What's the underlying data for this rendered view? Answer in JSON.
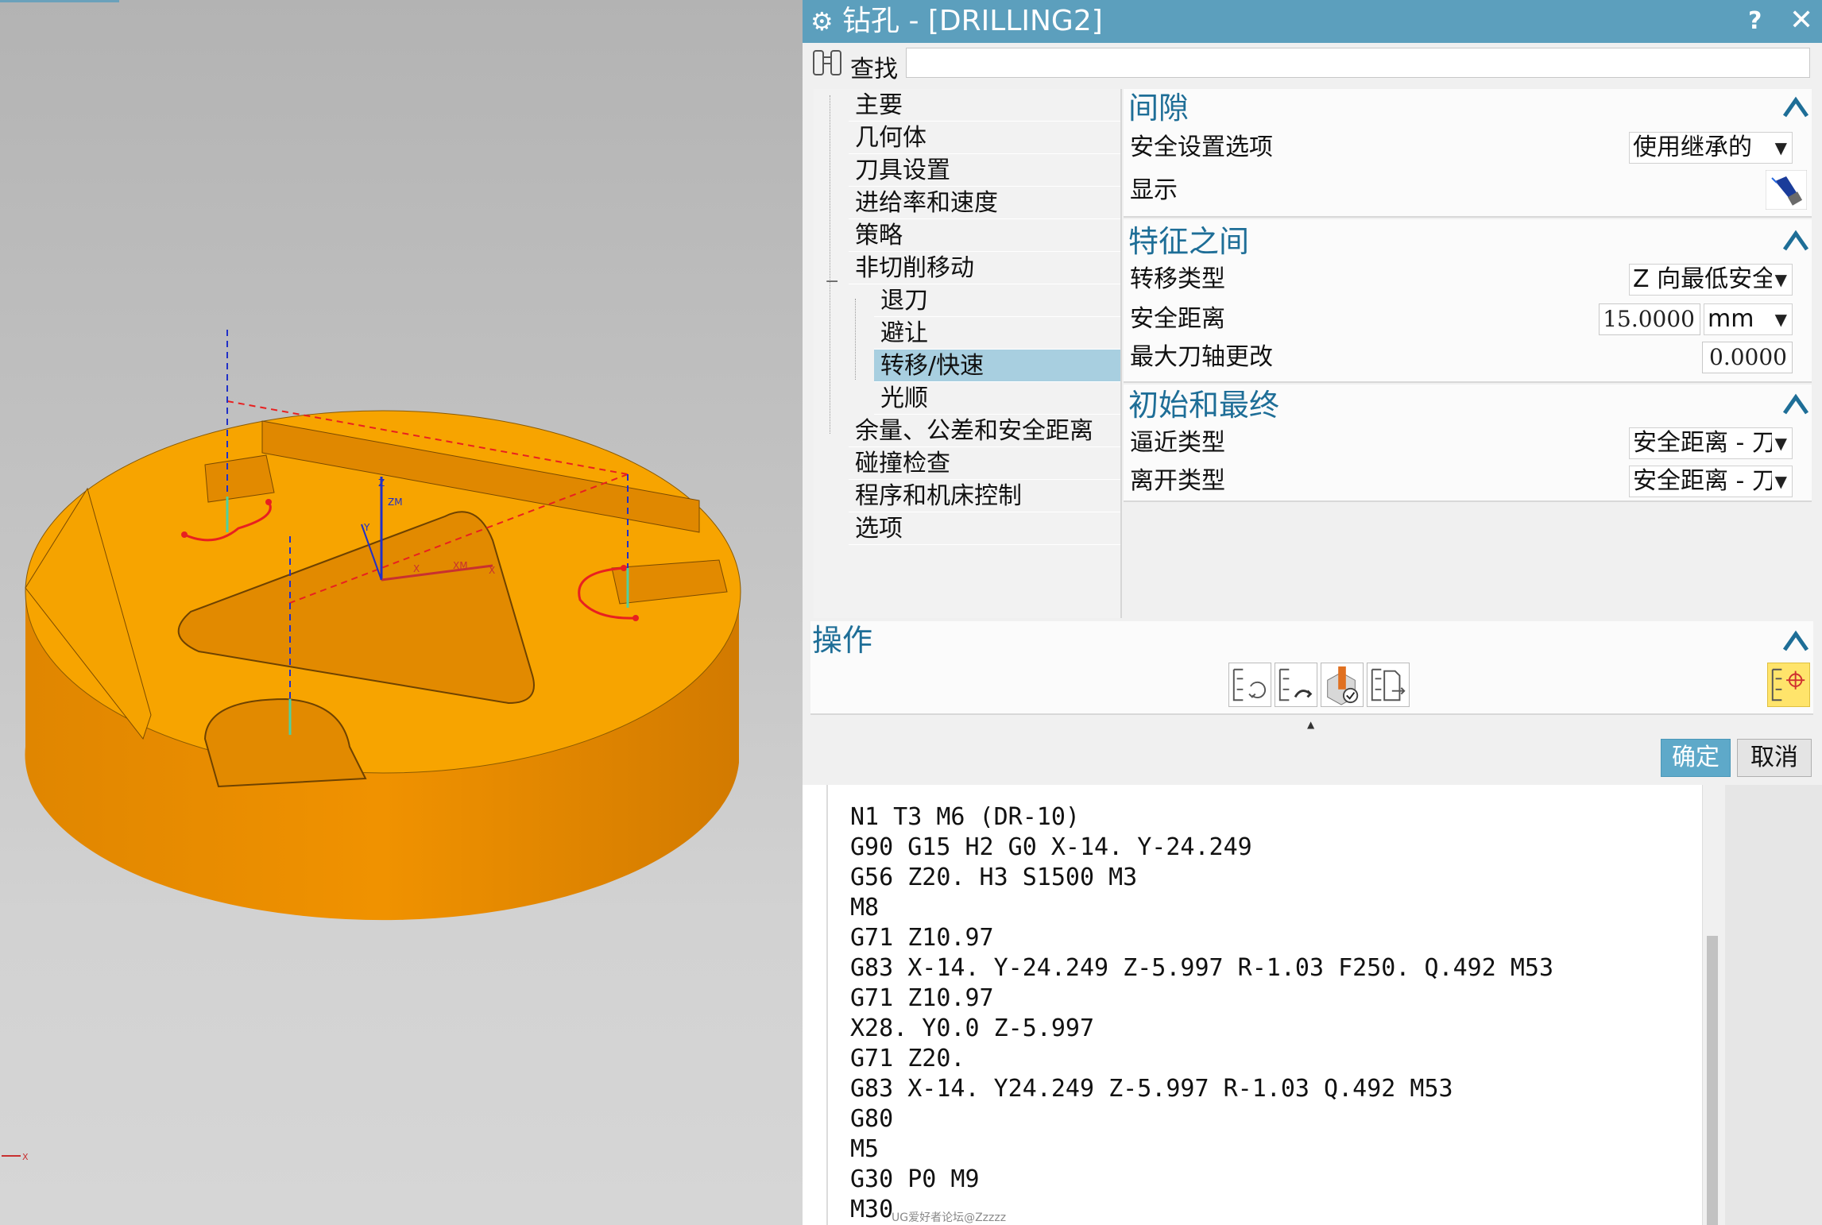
{
  "dialog": {
    "title": "钻孔 - [DRILLING2]",
    "help_label": "?",
    "close_label": "✕",
    "find_label": "查找",
    "find_value": ""
  },
  "tree": {
    "items": [
      {
        "label": "主要"
      },
      {
        "label": "几何体"
      },
      {
        "label": "刀具设置"
      },
      {
        "label": "进给率和速度"
      },
      {
        "label": "策略"
      },
      {
        "label": "非切削移动"
      },
      {
        "label": "退刀"
      },
      {
        "label": "避让"
      },
      {
        "label": "转移/快速"
      },
      {
        "label": "光顺"
      },
      {
        "label": "余量、公差和安全距离"
      },
      {
        "label": "碰撞检查"
      },
      {
        "label": "程序和机床控制"
      },
      {
        "label": "选项"
      }
    ],
    "collapse_symbol": "−",
    "selected": "转移/快速"
  },
  "clearance": {
    "title": "间隙",
    "safety_option_label": "安全设置选项",
    "safety_option_value": "使用继承的",
    "display_label": "显示"
  },
  "between_features": {
    "title": "特征之间",
    "transfer_type_label": "转移类型",
    "transfer_type_value": "Z 向最低安全",
    "safe_distance_label": "安全距离",
    "safe_distance_value": "15.0000",
    "safe_distance_unit": "mm",
    "max_axis_change_label": "最大刀轴更改",
    "max_axis_change_value": "0.0000"
  },
  "initial_final": {
    "title": "初始和最终",
    "approach_type_label": "逼近类型",
    "approach_type_value": "安全距离 - 刀",
    "departure_type_label": "离开类型",
    "departure_type_value": "安全距离 - 刀"
  },
  "operations": {
    "title": "操作",
    "icons": [
      "generate-icon",
      "replay-icon",
      "verify-icon",
      "list-icon",
      "postprocess-icon"
    ]
  },
  "buttons": {
    "ok": "确定",
    "cancel": "取消"
  },
  "viewport": {
    "axis_labels": {
      "zm": "ZM",
      "xm": "XM",
      "z": "Z",
      "x": "X",
      "y": "Y",
      "corner_x": "X"
    },
    "part_color": "#f5a000",
    "path_color": "#e82020",
    "axis_color": "#2030c8"
  },
  "nc_code": {
    "lines": [
      "N1 T3 M6 (DR-10)",
      "G90 G15 H2 G0 X-14. Y-24.249",
      "G56 Z20. H3 S1500 M3",
      "M8",
      "G71 Z10.97",
      "G83 X-14. Y-24.249 Z-5.997 R-1.03 F250. Q.492 M53",
      "G71 Z10.97",
      "X28. Y0.0 Z-5.997",
      "G71 Z20.",
      "G83 X-14. Y24.249 Z-5.997 R-1.03 Q.492 M53",
      "G80",
      "M5",
      "G30 P0 M9",
      "M30"
    ]
  },
  "watermark": "UG爱好者论坛@Zzzzz"
}
